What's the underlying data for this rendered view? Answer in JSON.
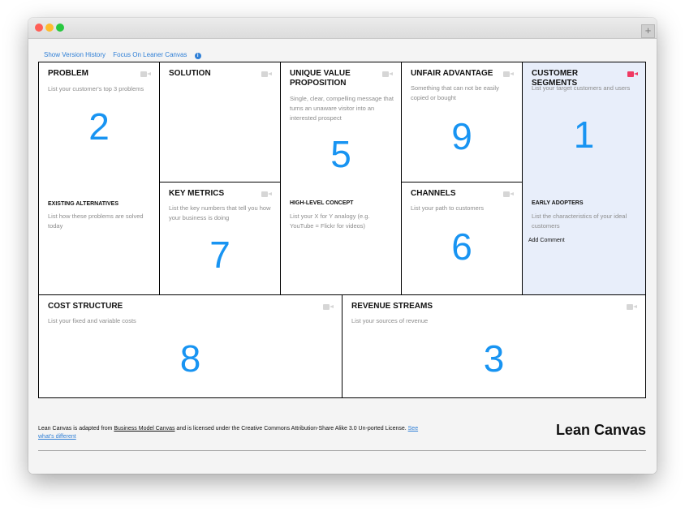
{
  "toolbar": {
    "show_version_history": "Show Version History",
    "focus_leaner_canvas": "Focus On Leaner Canvas",
    "info_glyph": "i"
  },
  "window": {
    "new_tab_label": "+"
  },
  "blocks": {
    "problem": {
      "title": "PROBLEM",
      "description": "List your customer's top 3 problems",
      "number": "2",
      "sub_title": "EXISTING ALTERNATIVES",
      "sub_description": "List how these problems are solved today"
    },
    "solution": {
      "title": "SOLUTION"
    },
    "key_metrics": {
      "title": "KEY METRICS",
      "description": "List the key numbers that tell you how your business is doing",
      "number": "7"
    },
    "uvp": {
      "title": "UNIQUE VALUE PROPOSITION",
      "description": "Single, clear, compelling message that turns an unaware visitor into an interested prospect",
      "number": "5",
      "sub_title": "HIGH-LEVEL CONCEPT",
      "sub_description": "List your X for Y analogy (e.g. YouTube = Flickr for videos)"
    },
    "unfair_advantage": {
      "title": "UNFAIR ADVANTAGE",
      "description": "Something that can not be easily copied or bought",
      "number": "9"
    },
    "channels": {
      "title": "CHANNELS",
      "description": "List your path to customers",
      "number": "6"
    },
    "customer_segments": {
      "title": "CUSTOMER SEGMENTS",
      "description": "List your target customers and users",
      "number": "1",
      "sub_title": "EARLY ADOPTERS",
      "sub_description": "List the characteristics of your ideal customers",
      "add_comment": "Add Comment"
    },
    "cost_structure": {
      "title": "COST STRUCTURE",
      "description": "List your fixed and variable costs",
      "number": "8"
    },
    "revenue_streams": {
      "title": "REVENUE STREAMS",
      "description": "List your sources of revenue",
      "number": "3"
    }
  },
  "footer": {
    "text_1": "Lean Canvas is adapted from ",
    "link_bmc": "Business Model Canvas",
    "text_2": " and is licensed under the Creative Commons Attribution-Share Alike 3.0 Un-ported License. ",
    "link_different": "See what's different",
    "brand": "Lean Canvas"
  },
  "icons": {
    "block_icon": "video-camera-icon",
    "info": "info-icon"
  },
  "colors": {
    "number": "#1894f2",
    "link": "#2f7fd6",
    "highlight_bg": "#e8eefa",
    "active_camera": "#ef3a63",
    "inactive_camera": "#d6d6d6"
  }
}
